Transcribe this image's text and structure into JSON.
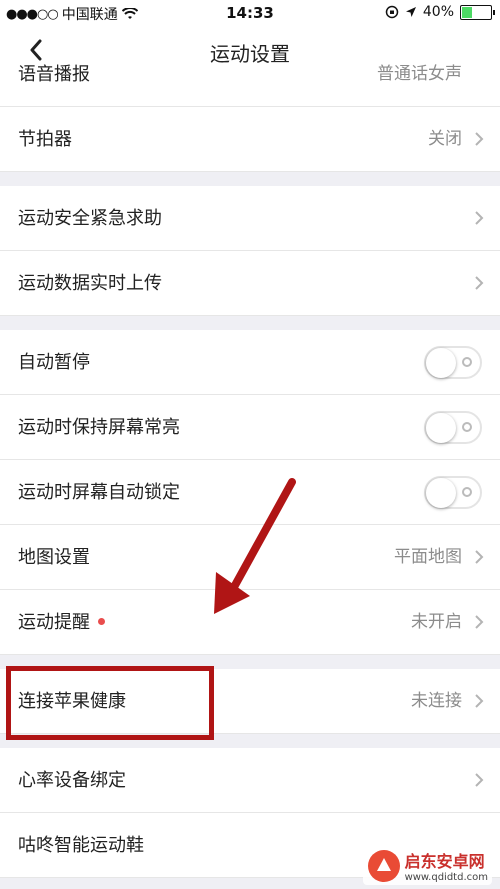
{
  "status_bar": {
    "signal": "●●●○○",
    "carrier": "中国联通",
    "time": "14:33",
    "battery": "40%",
    "battery_level": 0.4
  },
  "nav": {
    "title": "运动设置"
  },
  "sections": [
    {
      "rows": [
        {
          "label": "语音播报",
          "value": "普通话女声",
          "type": "link",
          "partial": true
        },
        {
          "label": "节拍器",
          "value": "关闭",
          "type": "link"
        }
      ]
    },
    {
      "rows": [
        {
          "label": "运动安全紧急求助",
          "value": "",
          "type": "link"
        },
        {
          "label": "运动数据实时上传",
          "value": "",
          "type": "link"
        }
      ]
    },
    {
      "rows": [
        {
          "label": "自动暂停",
          "type": "toggle",
          "on": false
        },
        {
          "label": "运动时保持屏幕常亮",
          "type": "toggle",
          "on": false
        },
        {
          "label": "运动时屏幕自动锁定",
          "type": "toggle",
          "on": false
        },
        {
          "label": "地图设置",
          "value": "平面地图",
          "type": "link"
        },
        {
          "label": "运动提醒",
          "value": "未开启",
          "type": "link",
          "dot": true
        }
      ]
    },
    {
      "rows": [
        {
          "label": "连接苹果健康",
          "value": "未连接",
          "type": "link"
        }
      ]
    },
    {
      "rows": [
        {
          "label": "心率设备绑定",
          "value": "",
          "type": "link"
        },
        {
          "label": "咕咚智能运动鞋",
          "value": "",
          "type": "link"
        }
      ]
    }
  ],
  "colors": {
    "annotation": "#b01515",
    "accent_dot": "#e94d4d"
  },
  "watermark": {
    "name": "启东安卓网",
    "url": "www.qdidtd.com"
  }
}
